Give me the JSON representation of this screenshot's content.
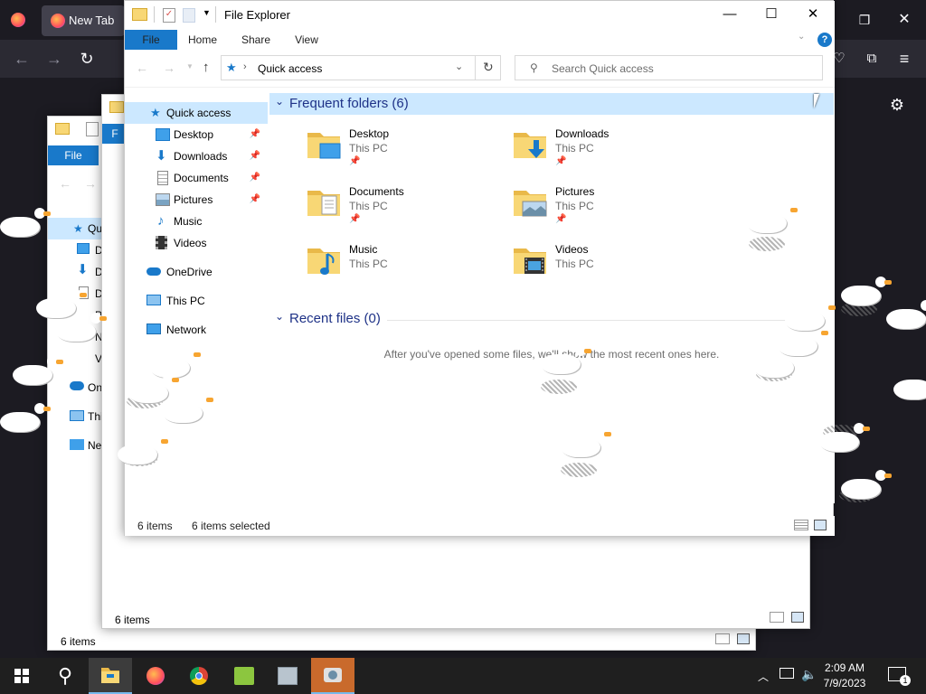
{
  "firefox": {
    "tab_title": "New Tab"
  },
  "back_window_1": {
    "file_tab": "File",
    "nav_items": [
      "Qu",
      "D",
      "D",
      "D",
      "P",
      "N",
      "V",
      "On",
      "Thi",
      "Ne"
    ],
    "status": "6 items"
  },
  "back_window_2": {
    "file_tab": "F",
    "status": "6 items"
  },
  "explorer": {
    "title": "File Explorer",
    "ribbon_tabs": [
      "File",
      "Home",
      "Share",
      "View"
    ],
    "address": "Quick access",
    "search_placeholder": "Search Quick access",
    "nav": {
      "quick_access": "Quick access",
      "items": [
        {
          "label": "Desktop",
          "icon": "desktop-icon",
          "pinned": true
        },
        {
          "label": "Downloads",
          "icon": "download-icon",
          "pinned": true
        },
        {
          "label": "Documents",
          "icon": "document-icon",
          "pinned": true
        },
        {
          "label": "Pictures",
          "icon": "pictures-icon",
          "pinned": true
        },
        {
          "label": "Music",
          "icon": "music-icon",
          "pinned": false
        },
        {
          "label": "Videos",
          "icon": "videos-icon",
          "pinned": false
        }
      ],
      "onedrive": "OneDrive",
      "this_pc": "This PC",
      "network": "Network"
    },
    "frequent_header": "Frequent folders (6)",
    "folders": [
      {
        "name": "Desktop",
        "location": "This PC",
        "icon": "desktop-folder-icon"
      },
      {
        "name": "Downloads",
        "location": "This PC",
        "icon": "downloads-folder-icon"
      },
      {
        "name": "Documents",
        "location": "This PC",
        "icon": "documents-folder-icon"
      },
      {
        "name": "Pictures",
        "location": "This PC",
        "icon": "pictures-folder-icon"
      },
      {
        "name": "Music",
        "location": "This PC",
        "icon": "music-folder-icon"
      },
      {
        "name": "Videos",
        "location": "This PC",
        "icon": "videos-folder-icon"
      }
    ],
    "recent_header": "Recent files (0)",
    "empty_message": "After you've opened some files, we'll show the most recent ones here.",
    "status_count": "6 items",
    "status_selected": "6 items selected"
  },
  "taskbar": {
    "time": "2:09 AM",
    "date": "7/9/2023",
    "notification_count": "1"
  },
  "colors": {
    "accent": "#1979ca",
    "header_bg": "#cce8ff",
    "header_text": "#1e3287",
    "folder_yellow": "#f8d775"
  }
}
